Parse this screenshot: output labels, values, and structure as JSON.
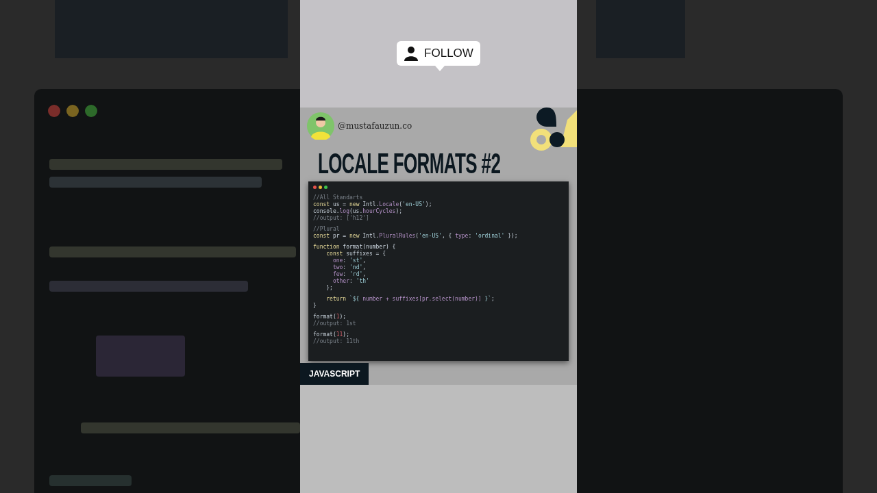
{
  "follow_button": {
    "label": "FOLLOW"
  },
  "author": {
    "handle": "@mustafauzun.co"
  },
  "title": "LOCALE FORMATS #2",
  "code_window": {
    "blocks": [
      [
        [
          {
            "kind": "comment",
            "text": "//All Standarts"
          }
        ],
        [
          {
            "kind": "keyword",
            "text": "const"
          },
          {
            "kind": "plain",
            "text": " us = "
          },
          {
            "kind": "keyword",
            "text": "new"
          },
          {
            "kind": "plain",
            "text": " Intl."
          },
          {
            "kind": "function",
            "text": "Locale"
          },
          {
            "kind": "plain",
            "text": "("
          },
          {
            "kind": "string",
            "text": "'en-US'"
          },
          {
            "kind": "plain",
            "text": ");"
          }
        ],
        [
          {
            "kind": "plain",
            "text": "console."
          },
          {
            "kind": "function",
            "text": "log"
          },
          {
            "kind": "plain",
            "text": "(us."
          },
          {
            "kind": "function",
            "text": "hourCycles"
          },
          {
            "kind": "plain",
            "text": ");"
          }
        ],
        [
          {
            "kind": "comment",
            "text": "//output: ['h12']"
          }
        ]
      ],
      [
        [
          {
            "kind": "comment",
            "text": "//Plural"
          }
        ],
        [
          {
            "kind": "keyword",
            "text": "const"
          },
          {
            "kind": "plain",
            "text": " pr = "
          },
          {
            "kind": "keyword",
            "text": "new"
          },
          {
            "kind": "plain",
            "text": " Intl."
          },
          {
            "kind": "function",
            "text": "PluralRules"
          },
          {
            "kind": "plain",
            "text": "("
          },
          {
            "kind": "string",
            "text": "'en-US'"
          },
          {
            "kind": "plain",
            "text": ", { "
          },
          {
            "kind": "function",
            "text": "type"
          },
          {
            "kind": "plain",
            "text": ": "
          },
          {
            "kind": "string",
            "text": "'ordinal'"
          },
          {
            "kind": "plain",
            "text": " });"
          }
        ]
      ],
      [
        [
          {
            "kind": "keyword",
            "text": "function"
          },
          {
            "kind": "plain",
            "text": " format(number) {"
          }
        ],
        [
          {
            "kind": "keyword",
            "text": "    const"
          },
          {
            "kind": "plain",
            "text": " suffixes = {"
          }
        ],
        [
          {
            "kind": "function",
            "text": "      one"
          },
          {
            "kind": "plain",
            "text": ": "
          },
          {
            "kind": "string",
            "text": "'st'"
          },
          {
            "kind": "plain",
            "text": ","
          }
        ],
        [
          {
            "kind": "function",
            "text": "      two"
          },
          {
            "kind": "plain",
            "text": ": "
          },
          {
            "kind": "string",
            "text": "'nd'"
          },
          {
            "kind": "plain",
            "text": ","
          }
        ],
        [
          {
            "kind": "function",
            "text": "      few"
          },
          {
            "kind": "plain",
            "text": ": "
          },
          {
            "kind": "string",
            "text": "'rd'"
          },
          {
            "kind": "plain",
            "text": ","
          }
        ],
        [
          {
            "kind": "function",
            "text": "      other"
          },
          {
            "kind": "plain",
            "text": ": "
          },
          {
            "kind": "string",
            "text": "'th'"
          }
        ],
        [
          {
            "kind": "plain",
            "text": "    };"
          }
        ]
      ],
      [
        [
          {
            "kind": "keyword",
            "text": "    return"
          },
          {
            "kind": "string",
            "text": " `${"
          },
          {
            "kind": "function",
            "text": " number + suffixes[pr.select(number)] "
          },
          {
            "kind": "string",
            "text": "}`"
          },
          {
            "kind": "plain",
            "text": ";"
          }
        ],
        [
          {
            "kind": "plain",
            "text": "}"
          }
        ]
      ],
      [
        [
          {
            "kind": "plain",
            "text": "format("
          },
          {
            "kind": "number",
            "text": "1"
          },
          {
            "kind": "plain",
            "text": ");"
          }
        ],
        [
          {
            "kind": "comment",
            "text": "//output: 1st"
          }
        ]
      ],
      [
        [
          {
            "kind": "plain",
            "text": "format("
          },
          {
            "kind": "number",
            "text": "11"
          },
          {
            "kind": "plain",
            "text": ");"
          }
        ],
        [
          {
            "kind": "comment",
            "text": "//output: 11th"
          }
        ]
      ]
    ]
  },
  "tag": "JAVASCRIPT"
}
